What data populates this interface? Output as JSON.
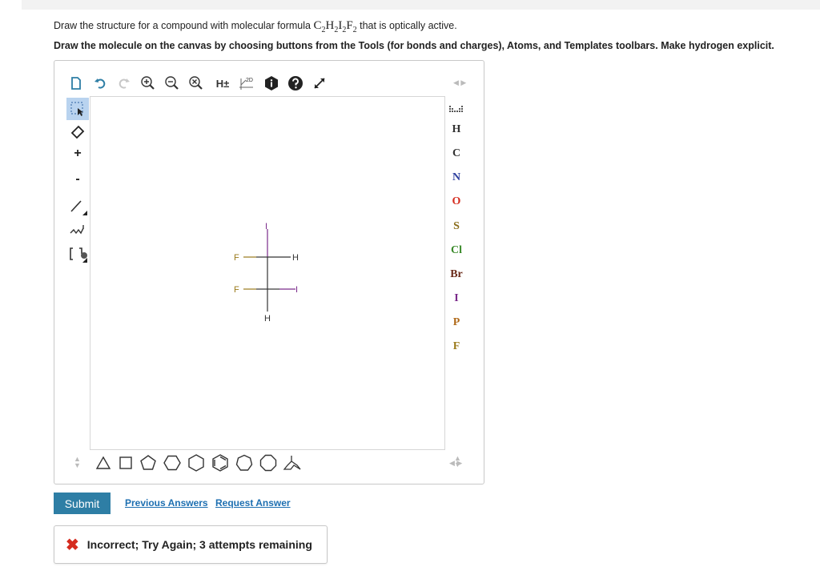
{
  "question": {
    "line1_prefix": "Draw the structure for a compound with molecular formula ",
    "formula": {
      "c": "C",
      "c_sub": "2",
      "h": "H",
      "h_sub": "2",
      "i": "I",
      "i_sub": "2",
      "f": "F",
      "f_sub": "2"
    },
    "line1_suffix": " that is optically active.",
    "line2": "Draw the molecule on the canvas by choosing buttons from the Tools (for bonds and charges), Atoms, and Templates toolbars. Make hydrogen explicit."
  },
  "toolbar": {
    "h_toggle": "H±",
    "dim_label": "2D"
  },
  "left_tools": {
    "plus": "+",
    "minus": "-"
  },
  "atoms": [
    {
      "symbol": "H",
      "color": "#333333"
    },
    {
      "symbol": "C",
      "color": "#333333"
    },
    {
      "symbol": "N",
      "color": "#2c3e9e"
    },
    {
      "symbol": "O",
      "color": "#d52b1e"
    },
    {
      "symbol": "S",
      "color": "#8a6d1a"
    },
    {
      "symbol": "Cl",
      "color": "#3a8a2a"
    },
    {
      "symbol": "Br",
      "color": "#6a2a1a"
    },
    {
      "symbol": "I",
      "color": "#7a2a8a"
    },
    {
      "symbol": "P",
      "color": "#b06a1a"
    },
    {
      "symbol": "F",
      "color": "#9a7a1a"
    }
  ],
  "molecule": {
    "labels": {
      "top": "I",
      "f_upper": "F",
      "h_upper": "H",
      "f_lower": "F",
      "i_lower": "I",
      "bottom": "H"
    }
  },
  "actions": {
    "submit": "Submit",
    "previous_answers": "Previous Answers",
    "request_answer": "Request Answer"
  },
  "feedback": {
    "message": "Incorrect; Try Again; 3 attempts remaining"
  },
  "colors": {
    "accent": "#2e7ea5",
    "link": "#1d6fb1",
    "error": "#d52b1e",
    "iodine": "#7a2a8a",
    "fluorine": "#9a7a1a"
  }
}
